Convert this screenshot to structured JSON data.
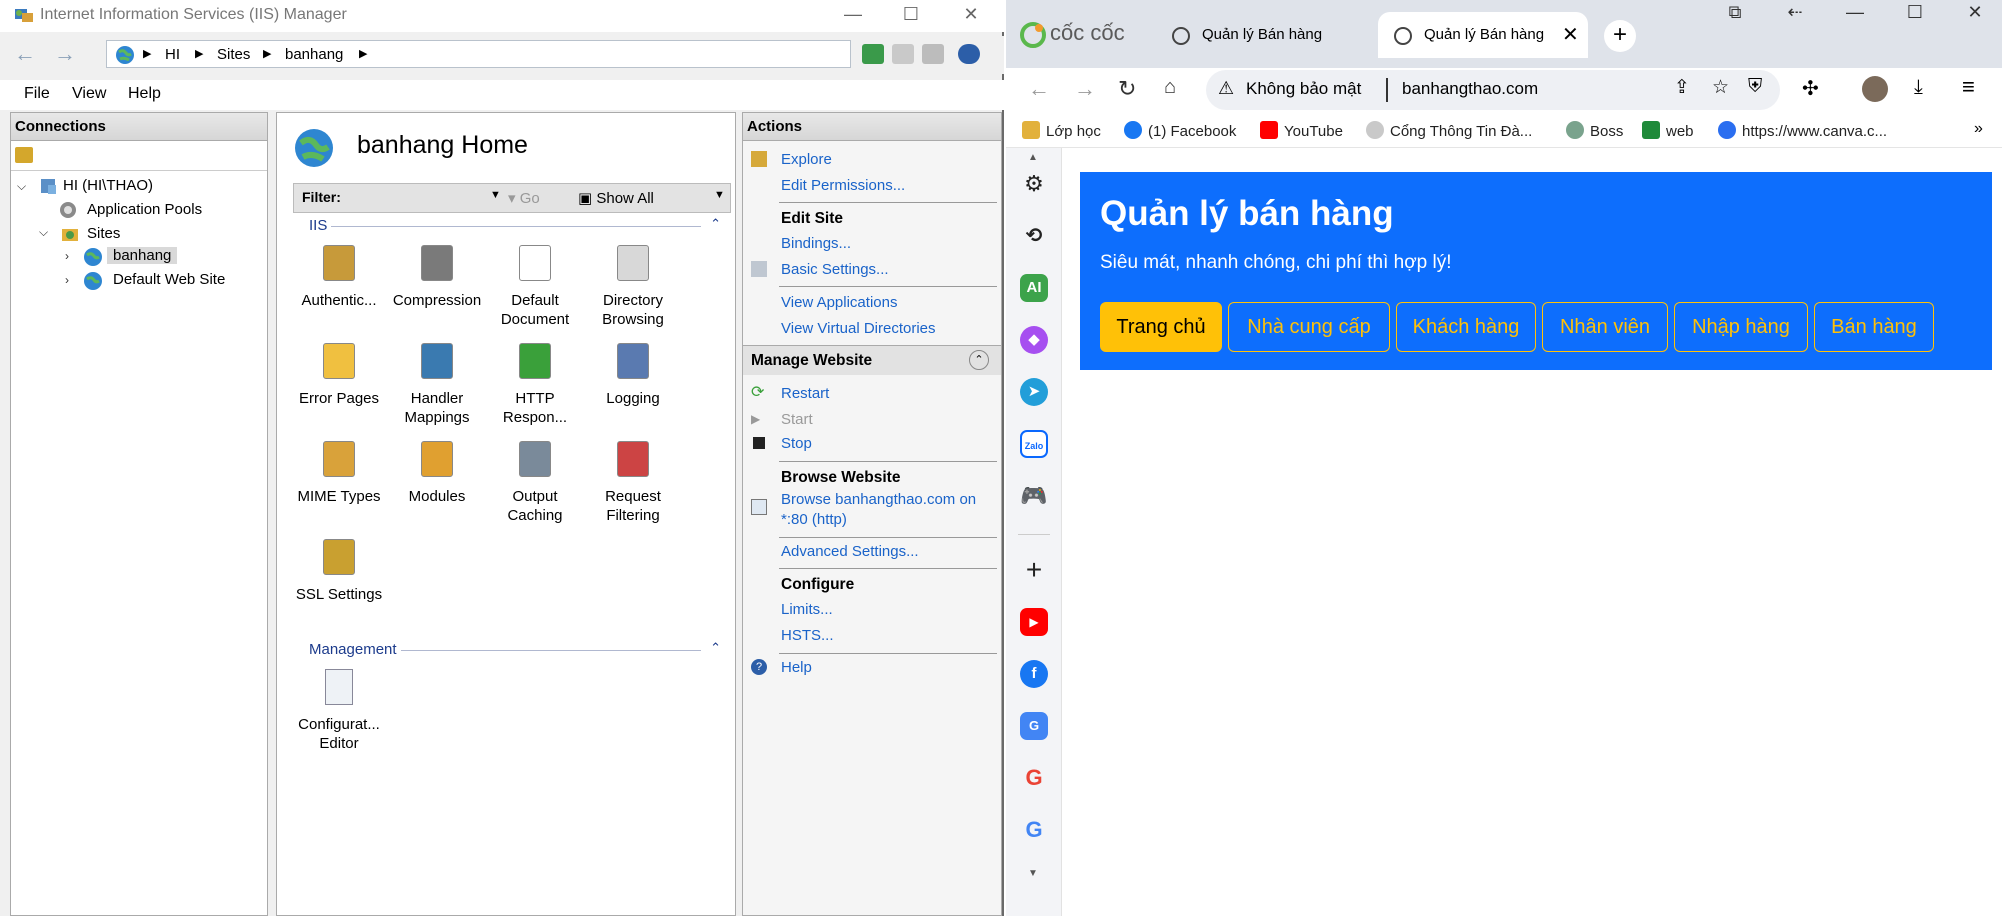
{
  "iis": {
    "title": "Internet Information Services (IIS) Manager",
    "breadcrumb": [
      "HI",
      "Sites",
      "banhang"
    ],
    "menu": [
      "File",
      "View",
      "Help"
    ],
    "connections": {
      "header": "Connections",
      "tree": {
        "server": "HI (HI\\THAO)",
        "app_pools": "Application Pools",
        "sites": "Sites",
        "site_selected": "banhang",
        "site_default": "Default Web Site"
      }
    },
    "home": {
      "title": "banhang Home",
      "filter_label": "Filter:",
      "go_label": "Go",
      "show_all_label": "Show All",
      "group_iis": "IIS",
      "group_management": "Management",
      "features_iis": [
        [
          "Authentic..."
        ],
        [
          "Compression"
        ],
        [
          "Default",
          "Document"
        ],
        [
          "Directory",
          "Browsing"
        ],
        [
          "Error Pages"
        ],
        [
          "Handler",
          "Mappings"
        ],
        [
          "HTTP",
          "Respon..."
        ],
        [
          "Logging"
        ],
        [
          "MIME Types"
        ],
        [
          "Modules"
        ],
        [
          "Output",
          "Caching"
        ],
        [
          "Request",
          "Filtering"
        ],
        [
          "SSL Settings"
        ]
      ],
      "features_management": [
        [
          "Configurat...",
          "Editor"
        ]
      ]
    },
    "actions": {
      "header": "Actions",
      "explore": "Explore",
      "edit_permissions": "Edit Permissions...",
      "edit_site": "Edit Site",
      "bindings": "Bindings...",
      "basic_settings": "Basic Settings...",
      "view_applications": "View Applications",
      "view_virtual_dirs": "View Virtual Directories",
      "manage_website": "Manage Website",
      "restart": "Restart",
      "start": "Start",
      "stop": "Stop",
      "browse_website": "Browse Website",
      "browse_link_1": "Browse banhangthao.com on",
      "browse_link_2": "*:80 (http)",
      "advanced_settings": "Advanced Settings...",
      "configure": "Configure",
      "limits": "Limits...",
      "hsts": "HSTS...",
      "help": "Help"
    }
  },
  "browser": {
    "brand": "cốc cốc",
    "tabs": [
      "Quản lý Bán hàng",
      "Quản lý Bán hàng"
    ],
    "security_label": "Không bảo mật",
    "url": "banhangthao.com",
    "bookmarks": [
      "Lớp học",
      "(1) Facebook",
      "YouTube",
      "Cổng Thông Tin Đà...",
      "Boss",
      "web",
      "https://www.canva.c..."
    ],
    "sidebar_ai_label": "AI",
    "colors": {
      "page_bg": "#0d6efd",
      "accent": "#ffc107"
    }
  },
  "page": {
    "title": "Quản lý bán hàng",
    "subtitle": "Siêu mát, nhanh chóng, chi phí thì hợp lý!",
    "nav": [
      "Trang chủ",
      "Nhà cung cấp",
      "Khách hàng",
      "Nhân viên",
      "Nhập hàng",
      "Bán hàng"
    ]
  }
}
